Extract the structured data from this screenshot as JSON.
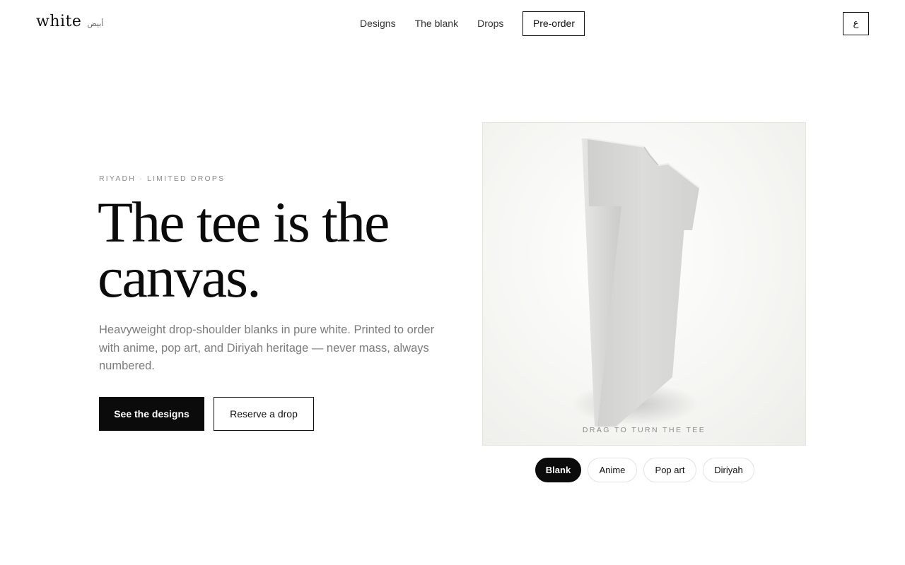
{
  "header": {
    "brand": "white",
    "brand_arabic": "أبيض",
    "nav": [
      "Designs",
      "The blank",
      "Drops"
    ],
    "cta": "Pre-order",
    "lang_toggle": "ع"
  },
  "hero": {
    "eyebrow": "RIYADH · LIMITED DROPS",
    "headline_line1": "The tee is the",
    "headline_line2": "canvas.",
    "subcopy": "Heavyweight drop-shoulder blanks in pure white. Printed to order with anime, pop art, and Diriyah heritage — never mass, always numbered.",
    "primary_button": "See the designs",
    "secondary_button": "Reserve a drop"
  },
  "viewer": {
    "hint": "DRAG TO TURN THE TEE",
    "styles": [
      {
        "label": "Blank",
        "active": true
      },
      {
        "label": "Anime",
        "active": false
      },
      {
        "label": "Pop art",
        "active": false
      },
      {
        "label": "Diriyah",
        "active": false
      }
    ]
  },
  "colors": {
    "ink": "#0b0b0b",
    "muted": "#7c7c7c",
    "viewer_bg": "#f6f6f3",
    "tee": "#d8d8d6"
  }
}
